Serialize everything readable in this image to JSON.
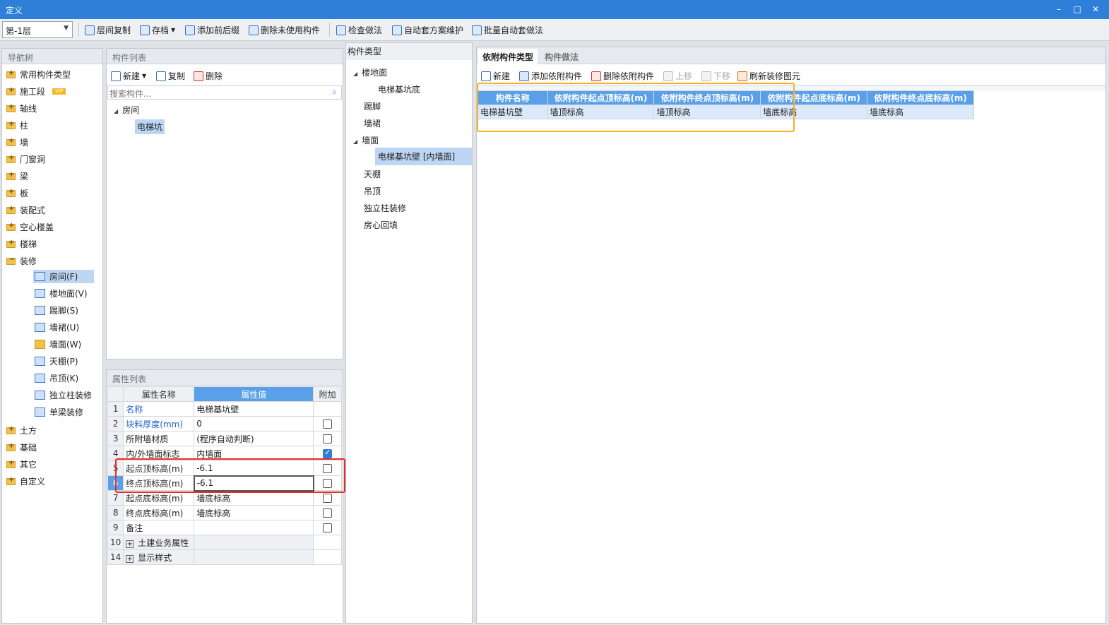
{
  "window": {
    "title": "定义"
  },
  "toolbar": {
    "floor": "第-1层",
    "buttons": [
      "层间复制",
      "存档",
      "添加前后缀",
      "删除未使用构件",
      "检查做法",
      "自动套方案维护",
      "批量自动套做法"
    ]
  },
  "nav": {
    "title": "导航树",
    "items": [
      {
        "label": "常用构件类型"
      },
      {
        "label": "施工段",
        "badge": "VIP"
      },
      {
        "label": "轴线"
      },
      {
        "label": "柱"
      },
      {
        "label": "墙"
      },
      {
        "label": "门窗洞"
      },
      {
        "label": "梁"
      },
      {
        "label": "板"
      },
      {
        "label": "装配式"
      },
      {
        "label": "空心楼盖"
      },
      {
        "label": "楼梯"
      },
      {
        "label": "装修"
      }
    ],
    "sub_items": [
      "房间(F)",
      "楼地面(V)",
      "踢脚(S)",
      "墙裙(U)",
      "墙面(W)",
      "天棚(P)",
      "吊顶(K)",
      "独立柱装修",
      "单梁装修"
    ],
    "bottom_items": [
      "土方",
      "基础",
      "其它",
      "自定义"
    ]
  },
  "component_list": {
    "title": "构件列表",
    "new": "新建",
    "copy": "复制",
    "delete": "删除",
    "search_placeholder": "搜索构件...",
    "tree_root": "房间",
    "tree_child": "电梯坑"
  },
  "properties": {
    "title": "属性列表",
    "headers": {
      "name": "属性名称",
      "value": "属性值",
      "extra": "附加"
    },
    "rows": [
      {
        "num": "1",
        "name": "名称",
        "value": "电梯基坑壁"
      },
      {
        "num": "2",
        "name": "块料厚度(mm)",
        "value": "0"
      },
      {
        "num": "3",
        "name": "所附墙材质",
        "value": "(程序自动判断)"
      },
      {
        "num": "4",
        "name": "内/外墙面标志",
        "value": "内墙面"
      },
      {
        "num": "5",
        "name": "起点顶标高(m)",
        "value": "-6.1"
      },
      {
        "num": "6",
        "name": "终点顶标高(m)",
        "value": "-6.1"
      },
      {
        "num": "7",
        "name": "起点底标高(m)",
        "value": "墙底标高"
      },
      {
        "num": "8",
        "name": "终点底标高(m)",
        "value": "墙底标高"
      },
      {
        "num": "9",
        "name": "备注",
        "value": ""
      },
      {
        "num": "10",
        "name": "土建业务属性",
        "value": ""
      },
      {
        "num": "14",
        "name": "显示样式",
        "value": ""
      }
    ]
  },
  "component_types": {
    "title": "构件类型",
    "items": [
      "楼地面",
      "电梯基坑底",
      "踢脚",
      "墙裙",
      "墙面",
      "电梯基坑壁 [内墙面]",
      "天棚",
      "吊顶",
      "独立柱装修",
      "房心回填"
    ]
  },
  "right": {
    "tabs": [
      "依附构件类型",
      "构件做法"
    ],
    "toolbar": [
      "新建",
      "添加依附构件",
      "删除依附构件",
      "上移",
      "下移",
      "刷新装修图元"
    ],
    "grid_headers": [
      "构件名称",
      "依附构件起点顶标高(m)",
      "依附构件终点顶标高(m)",
      "依附构件起点底标高(m)",
      "依附构件终点底标高(m)"
    ],
    "grid_row": [
      "电梯基坑壁",
      "墙顶标高",
      "墙顶标高",
      "墙底标高",
      "墙底标高"
    ]
  },
  "colors": {
    "titlebar": "#2d7fd8",
    "highlight_red": "#e52b2b",
    "highlight_orange": "#f5b225"
  }
}
